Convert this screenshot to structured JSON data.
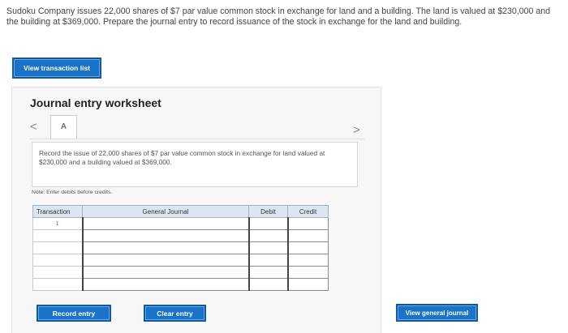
{
  "question": {
    "text": "Sudoku Company issues 22,000 shares of $7 par value common stock in exchange for land and a building. The land is valued at $230,000 and the building at $369,000. Prepare the journal entry to record issuance of the stock in exchange for the land and building."
  },
  "buttons": {
    "view_transaction_list": "View transaction list",
    "record_entry": "Record entry",
    "clear_entry": "Clear entry",
    "view_general_journal": "View general journal"
  },
  "worksheet": {
    "title": "Journal entry worksheet",
    "nav_prev": "<",
    "nav_next": ">",
    "tab_label": "A",
    "description": "Record the issue of 22,000 shares of $7 par value common stock in exchange for land valued at $230,000 and a building valued at $369,000.",
    "note": "Note: Enter debits before credits."
  },
  "journal_table": {
    "headers": {
      "transaction": "Transaction",
      "general_journal": "General Journal",
      "debit": "Debit",
      "credit": "Credit"
    },
    "rows": [
      {
        "transaction": "1",
        "account": "",
        "debit": "",
        "credit": ""
      },
      {
        "transaction": "",
        "account": "",
        "debit": "",
        "credit": ""
      },
      {
        "transaction": "",
        "account": "",
        "debit": "",
        "credit": ""
      },
      {
        "transaction": "",
        "account": "",
        "debit": "",
        "credit": ""
      },
      {
        "transaction": "",
        "account": "",
        "debit": "",
        "credit": ""
      },
      {
        "transaction": "",
        "account": "",
        "debit": "",
        "credit": ""
      }
    ]
  },
  "colors": {
    "button_blue": "#1a73c9",
    "header_bg": "#dbe6f1",
    "worksheet_bg": "#f6f7f6"
  }
}
